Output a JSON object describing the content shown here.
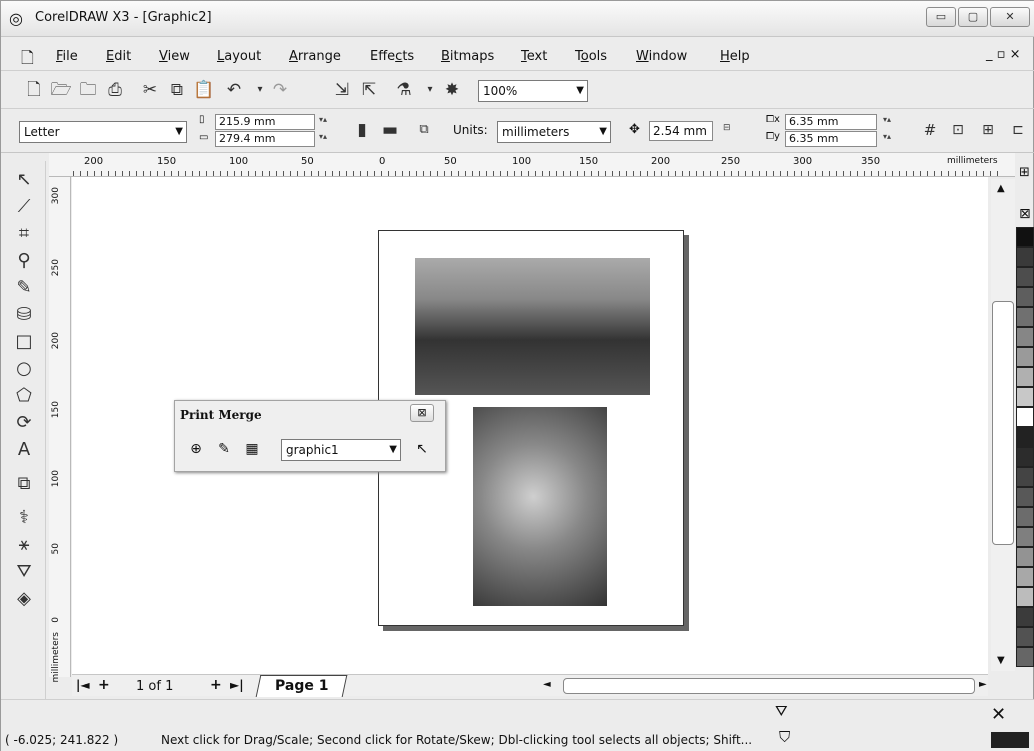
{
  "window": {
    "title": "CorelDRAW X3 - [Graphic2]",
    "min": "▭",
    "max": "▢",
    "close": "✕"
  },
  "menu": [
    "File",
    "Edit",
    "View",
    "Layout",
    "Arrange",
    "Effects",
    "Bitmaps",
    "Text",
    "Tools",
    "Window",
    "Help"
  ],
  "menu_underline": [
    "F",
    "E",
    "V",
    "L",
    "A",
    "c",
    "B",
    "T",
    "o",
    "W",
    "H"
  ],
  "standard_toolbar": {
    "zoom": "100%"
  },
  "property_bar": {
    "paper": "Letter",
    "width": "215.9 mm",
    "height": "279.4 mm",
    "units_label": "Units:",
    "units_value": "millimeters",
    "nudge": "2.54 mm",
    "dup_x": "6.35 mm",
    "dup_y": "6.35 mm"
  },
  "rulers": {
    "top": [
      "200",
      "150",
      "100",
      "50",
      "0",
      "50",
      "100",
      "150",
      "200",
      "250",
      "300",
      "350"
    ],
    "unit": "millimeters",
    "left": [
      "300",
      "250",
      "200",
      "150",
      "100",
      "50",
      "0"
    ],
    "left_unit": "millimeters"
  },
  "print_merge": {
    "title": "Print Merge",
    "close": "⊠",
    "combo": "graphic1"
  },
  "page_nav": {
    "first": "|◄",
    "add_before": "+",
    "count": "1 of 1",
    "add_after": "+",
    "last": "►|",
    "tab": "Page 1"
  },
  "status": {
    "coords": "( -6.025; 241.822 )",
    "hint": "Next click for Drag/Scale; Second click for Rotate/Skew; Dbl-clicking tool selects all objects; Shift..."
  },
  "palette": [
    "#111111",
    "#3a3a3a",
    "#4d4d4d",
    "#5e5e5e",
    "#707070",
    "#868686",
    "#9a9a9a",
    "#b0b0b0",
    "#c8c8c8",
    "#ffffff",
    "#222222",
    "#2c2c2c",
    "#444444",
    "#585858",
    "#6c6c6c",
    "#7f7f7f",
    "#939393",
    "#a8a8a8",
    "#bcbcbc",
    "#3b3b3b",
    "#525252",
    "#666666"
  ]
}
